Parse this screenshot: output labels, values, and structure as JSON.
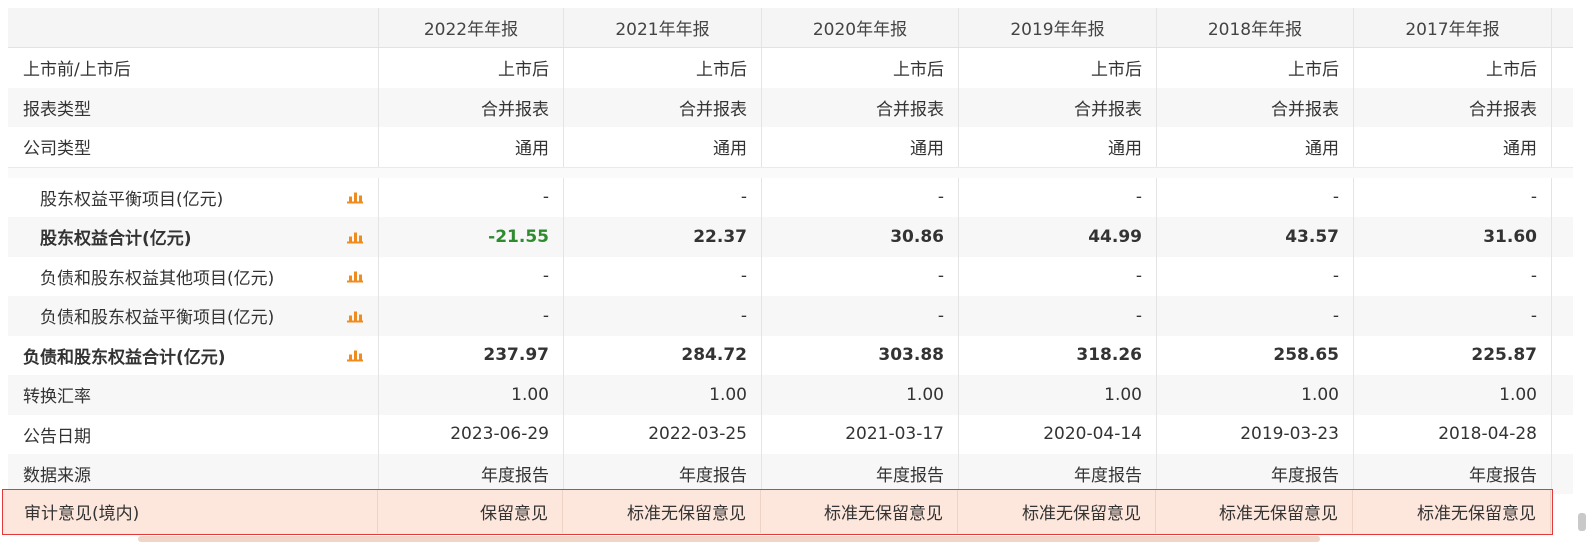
{
  "columns": [
    "2022年年报",
    "2021年年报",
    "2020年年报",
    "2019年年报",
    "2018年年报",
    "2017年年报"
  ],
  "top_rows": [
    {
      "label": "上市前/上市后",
      "values": [
        "上市后",
        "上市后",
        "上市后",
        "上市后",
        "上市后",
        "上市后"
      ]
    },
    {
      "label": "报表类型",
      "values": [
        "合并报表",
        "合并报表",
        "合并报表",
        "合并报表",
        "合并报表",
        "合并报表"
      ]
    },
    {
      "label": "公司类型",
      "values": [
        "通用",
        "通用",
        "通用",
        "通用",
        "通用",
        "通用"
      ]
    }
  ],
  "body_rows": [
    {
      "label": "股东权益平衡项目(亿元)",
      "values": [
        "-",
        "-",
        "-",
        "-",
        "-",
        "-"
      ]
    },
    {
      "label": "股东权益合计(亿元)",
      "values": [
        "-21.55",
        "22.37",
        "30.86",
        "44.99",
        "43.57",
        "31.60"
      ]
    },
    {
      "label": "负债和股东权益其他项目(亿元)",
      "values": [
        "-",
        "-",
        "-",
        "-",
        "-",
        "-"
      ]
    },
    {
      "label": "负债和股东权益平衡项目(亿元)",
      "values": [
        "-",
        "-",
        "-",
        "-",
        "-",
        "-"
      ]
    },
    {
      "label": "负债和股东权益合计(亿元)",
      "values": [
        "237.97",
        "284.72",
        "303.88",
        "318.26",
        "258.65",
        "225.87"
      ]
    },
    {
      "label": "转换汇率",
      "values": [
        "1.00",
        "1.00",
        "1.00",
        "1.00",
        "1.00",
        "1.00"
      ]
    },
    {
      "label": "公告日期",
      "values": [
        "2023-06-29",
        "2022-03-25",
        "2021-03-17",
        "2020-04-14",
        "2019-03-23",
        "2018-04-28"
      ]
    },
    {
      "label": "数据来源",
      "values": [
        "年度报告",
        "年度报告",
        "年度报告",
        "年度报告",
        "年度报告",
        "年度报告"
      ]
    }
  ],
  "audit_row": {
    "label": "审计意见(境内)",
    "values": [
      "保留意见",
      "标准无保留意见",
      "标准无保留意见",
      "标准无保留意见",
      "标准无保留意见",
      "标准无保留意见"
    ]
  },
  "colors": {
    "negative": "#2e8b2e",
    "highlight_border": "#e33b3b",
    "highlight_bg": "#fde7dc",
    "chart_icon": "#f08c1e"
  },
  "icons": {
    "row_chart": "bar-chart-icon"
  }
}
